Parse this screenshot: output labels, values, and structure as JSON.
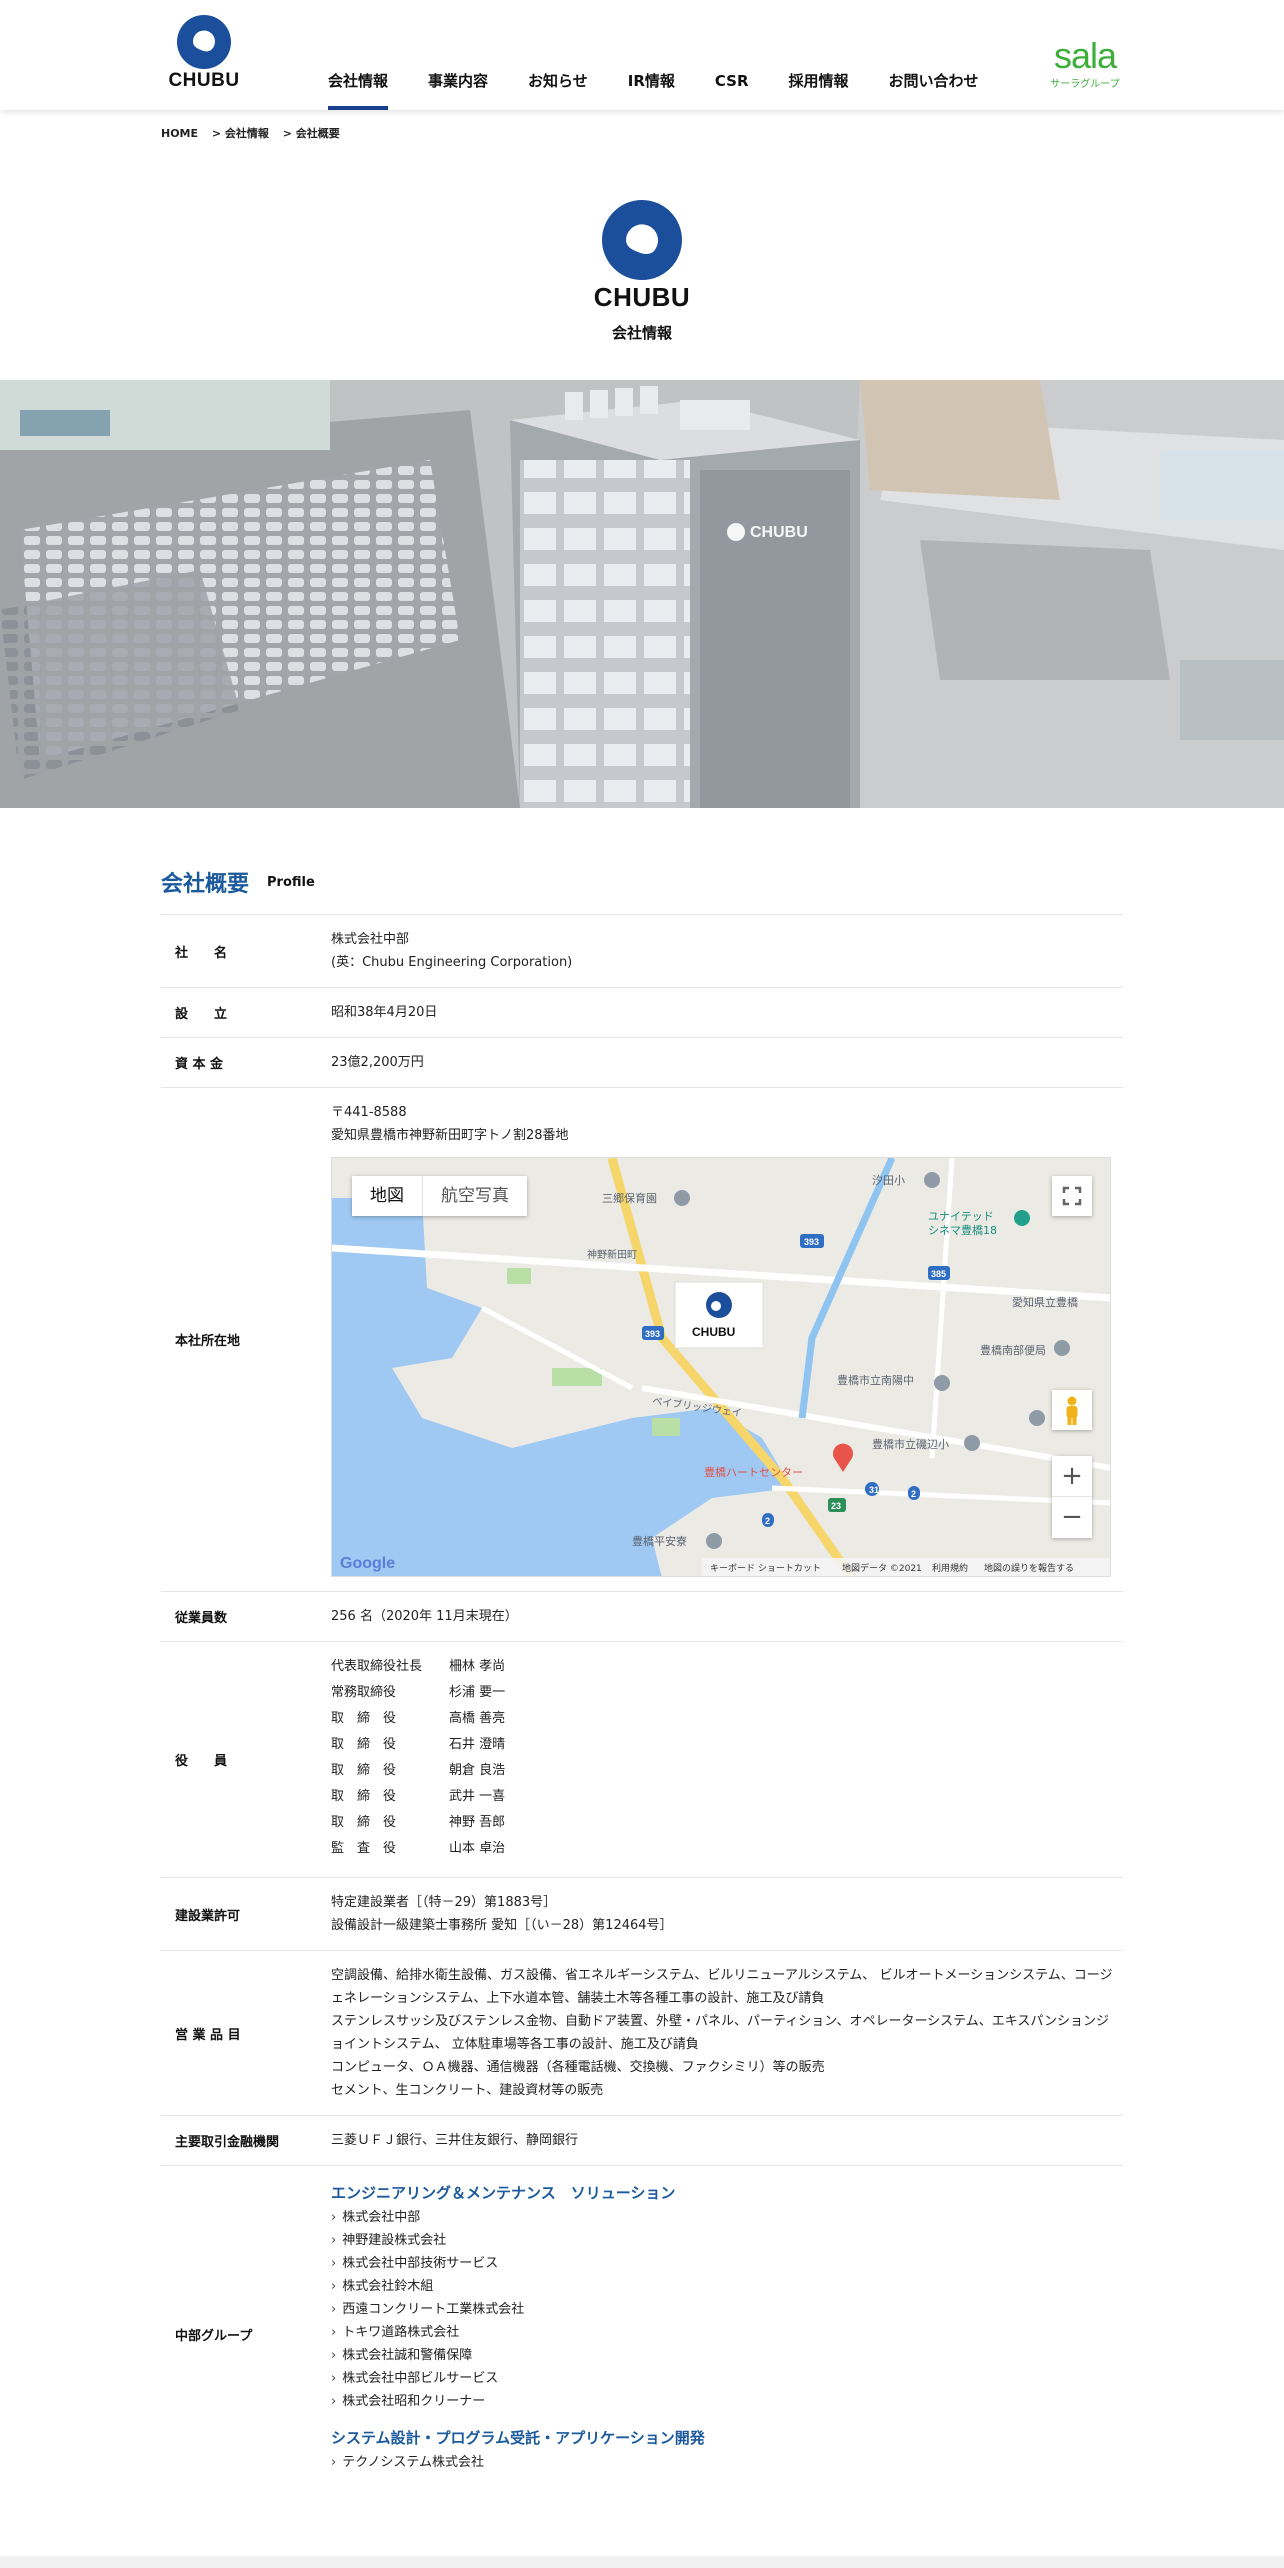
{
  "header": {
    "logo_text": "CHUBU",
    "nav": [
      "会社情報",
      "事業内容",
      "お知らせ",
      "IR情報",
      "CSR",
      "採用情報",
      "お問い合わせ"
    ],
    "sala_word": "sala",
    "sala_sub": "サーラグループ"
  },
  "breadcrumb": [
    "HOME",
    "> 会社情報",
    "> 会社概要"
  ],
  "hero": {
    "logo_text": "CHUBU",
    "title": "会社情報"
  },
  "section": {
    "title": "会社概要",
    "sub": "Profile"
  },
  "profile": {
    "name_label": "社　　名",
    "name_1": "株式会社中部",
    "name_2": "(英：Chubu Engineering Corporation)",
    "founded_label": "設　　立",
    "founded": "昭和38年4月20日",
    "capital_label": "資 本 金",
    "capital": "23億2,200万円",
    "hq_label": "本社所在地",
    "hq_zip": "〒441-8588",
    "hq_address": "愛知県豊橋市神野新田町字トノ割28番地",
    "employees_label": "従業員数",
    "employees": "256 名（2020年 11月末現在）",
    "officers_label": "役　　員",
    "officers": [
      {
        "pos": "代表取締役社長",
        "name": "柵林 孝尚"
      },
      {
        "pos": "常務取締役",
        "name": "杉浦 要一"
      },
      {
        "pos": "取　締　役",
        "name": "高橋 善亮"
      },
      {
        "pos": "取　締　役",
        "name": "石井 澄晴"
      },
      {
        "pos": "取　締　役",
        "name": "朝倉 良浩"
      },
      {
        "pos": "取　締　役",
        "name": "武井 一喜"
      },
      {
        "pos": "取　締　役",
        "name": "神野 吾郎"
      },
      {
        "pos": "監　査　役",
        "name": "山本 卓治"
      }
    ],
    "license_label": "建設業許可",
    "license_1": "特定建設業者［（特－29）第1883号］",
    "license_2": "設備設計一級建築士事務所 愛知［（い－28）第12464号］",
    "products_label": "営 業 品 目",
    "products": [
      "空調設備、給排水衛生設備、ガス設備、省エネルギーシステム、ビルリニューアルシステム、 ビルオートメーションシステム、コージェネレーションシステム、上下水道本管、舗装土木等各種工事の設計、施工及び請負",
      "ステンレスサッシ及びステンレス金物、自動ドア装置、外壁・パネル、パーティション、オペレーターシステム、エキスパンションジョイントシステム、 立体駐車場等各工事の設計、施工及び請負",
      "コンピュータ、ＯＡ機器、通信機器（各種電話機、交換機、ファクシミリ）等の販売",
      "セメント、生コンクリート、建設資材等の販売"
    ],
    "banks_label": "主要取引金融機関",
    "banks": "三菱ＵＦＪ銀行、三井住友銀行、静岡銀行",
    "group_label": "中部グループ",
    "group_head_1": "エンジニアリング＆メンテナンス　ソリューション",
    "group_items_1": [
      "株式会社中部",
      "神野建設株式会社",
      "株式会社中部技術サービス",
      "株式会社鈴木組",
      "西遠コンクリート工業株式会社",
      "トキワ道路株式会社",
      "株式会社誠和警備保障",
      "株式会社中部ビルサービス",
      "株式会社昭和クリーナー"
    ],
    "group_head_2": "システム設計・プログラム受託・アプリケーション開発",
    "group_items_2": [
      "テクノシステム株式会社"
    ]
  },
  "map": {
    "tab_map": "地図",
    "tab_satellite": "航空写真",
    "labels": [
      "汐田小",
      "三郷保育園",
      "ユナイテッド・シネマ豊橋18",
      "神野新田町",
      "愛知県立豊橋",
      "豊橋南部便局",
      "豊橋市立南陽中",
      "ベイブリッジウェイ",
      "豊橋市立磯辺小",
      "豊橋ハートセンター",
      "豊橋平安寮"
    ],
    "road_numbers": [
      "393",
      "385",
      "393",
      "2",
      "31",
      "2",
      "23"
    ],
    "logo_text": "CHUBU",
    "google": "Google",
    "footer": [
      "キーボード ショートカット",
      "地図データ ©2021",
      "利用規約",
      "地図の誤りを報告する"
    ],
    "zoom_in": "+",
    "zoom_out": "−"
  },
  "building_sign": "CHUBU",
  "colors": {
    "accent": "#1b5a9c",
    "nav_underline": "#1b3f8f",
    "sala_green": "#3dae3a"
  }
}
